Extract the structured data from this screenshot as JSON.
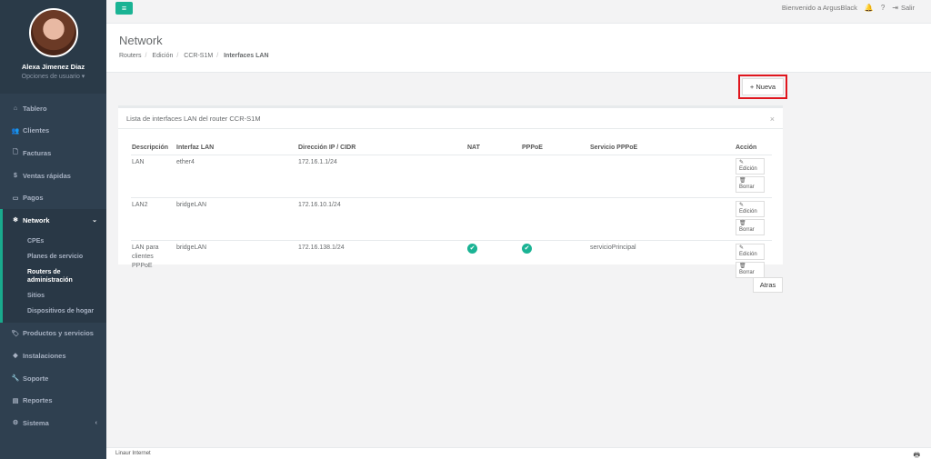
{
  "user": {
    "name": "Alexa Jimenez Diaz",
    "options": "Opciones de usuario ▾"
  },
  "nav": [
    {
      "icon": "⌂",
      "label": "Tablero"
    },
    {
      "icon": "👥",
      "label": "Clientes"
    },
    {
      "icon": "🗋",
      "label": "Facturas"
    },
    {
      "icon": "$",
      "label": "Ventas rápidas"
    },
    {
      "icon": "▭",
      "label": "Pagos"
    }
  ],
  "network": {
    "icon": "❄",
    "label": "Network",
    "caret": "⌄",
    "sub": [
      "CPEs",
      "Planes de servicio",
      "Routers de administración",
      "Sitios",
      "Dispositivos de hogar"
    ]
  },
  "nav2": [
    {
      "icon": "🏷",
      "label": "Productos y servicios"
    },
    {
      "icon": "◆",
      "label": "Instalaciones"
    },
    {
      "icon": "🔧",
      "label": "Soporte"
    },
    {
      "icon": "▤",
      "label": "Reportes"
    },
    {
      "icon": "⚙",
      "label": "Sistema",
      "caret": "‹"
    }
  ],
  "topbar": {
    "menu": "≡",
    "welcome": "Bienvenido a ArgusBlack",
    "bell": "🔔",
    "help": "?",
    "logout_icon": "⇥",
    "logout": "Salir"
  },
  "heading": {
    "title": "Network",
    "crumbs": [
      "Routers",
      "Edición",
      "CCR-S1M"
    ],
    "current": "Interfaces LAN"
  },
  "nueva": "+ Nueva",
  "panel": {
    "title": "Lista de interfaces LAN del router CCR-S1M",
    "close": "×"
  },
  "table": {
    "headers": [
      "Descripción",
      "Interfaz LAN",
      "Dirección IP / CIDR",
      "NAT",
      "PPPoE",
      "Servicio PPPoE",
      "Acción"
    ],
    "rows": [
      {
        "desc": "LAN",
        "iface": "ether4",
        "ip": "172.16.1.1/24",
        "nat": false,
        "pppoe": false,
        "svc": ""
      },
      {
        "desc": "LAN2",
        "iface": "bridgeLAN",
        "ip": "172.16.10.1/24",
        "nat": false,
        "pppoe": false,
        "svc": ""
      },
      {
        "desc": "LAN para clientes PPPoE",
        "iface": "bridgeLAN",
        "ip": "172.16.138.1/24",
        "nat": true,
        "pppoe": true,
        "svc": "servicioPrincipal"
      }
    ],
    "edit": "✎ Edición",
    "delete": "🗑 Borrar"
  },
  "atras": "Atras",
  "footer": {
    "text": "Linaur Internet",
    "icon": "🖶"
  },
  "colors": {
    "accent": "#1ab394",
    "sidebar": "#2f4050",
    "highlight": "#e0161e"
  }
}
